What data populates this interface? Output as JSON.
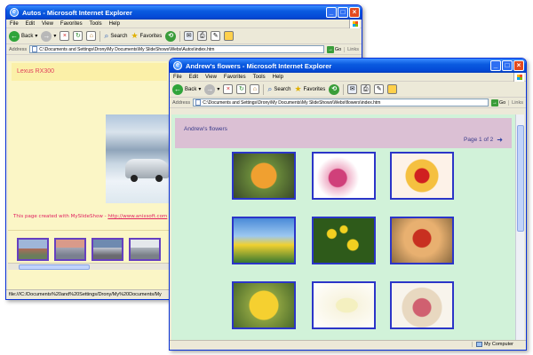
{
  "window1": {
    "title": "Autos - Microsoft Internet Explorer",
    "menu": [
      "File",
      "Edit",
      "View",
      "Favorites",
      "Tools",
      "Help"
    ],
    "toolbar": {
      "back": "Back",
      "search": "Search",
      "favorites": "Favorites"
    },
    "address_label": "Address",
    "address": "C:\\Documents and Settings\\Drony\\My Documents\\My SlideShows\\Webs\\Autos\\index.htm",
    "go": "Go",
    "links": "Links",
    "page_title": "Lexus RX300",
    "created_text": "This page created with MySlideShow - ",
    "created_link": "http://www.anixsoft.com",
    "status": "file:///C:/Documents%20and%20Settings/Drony/My%20Documents/My"
  },
  "window2": {
    "title": "Andrew's flowers - Microsoft Internet Explorer",
    "menu": [
      "File",
      "Edit",
      "View",
      "Favorites",
      "Tools",
      "Help"
    ],
    "toolbar": {
      "back": "Back",
      "search": "Search",
      "favorites": "Favorites"
    },
    "address_label": "Address",
    "address": "C:\\Documents and Settings\\Drony\\My Documents\\My SlideShows\\Webs\\flowers\\index.htm",
    "go": "Go",
    "links": "Links",
    "page_title": "Andrew's flowers",
    "pager": "Page 1 of 2",
    "status_zone": "My Computer"
  }
}
